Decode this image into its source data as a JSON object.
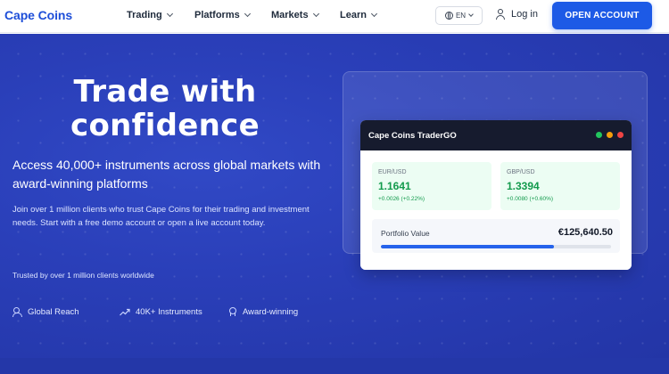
{
  "brand": {
    "name": "Cape Coins",
    "color": "#1d4ed8"
  },
  "nav": {
    "items": [
      {
        "label": "Trading"
      },
      {
        "label": "Platforms"
      },
      {
        "label": "Markets"
      },
      {
        "label": "Learn"
      }
    ],
    "language": "EN",
    "login_label": "Log in",
    "cta_label": "OPEN ACCOUNT",
    "cta_color": "#1d5ae6"
  },
  "hero": {
    "headline": [
      "Trade with",
      "confidence"
    ],
    "subhead": "Access 40,000+ instruments across global markets with award-winning platforms",
    "paragraph": "Join over 1 million clients who trust Cape Coins for their trading and investment needs. Start with a free demo account or open a live account today.",
    "trusted": "Trusted by over 1 million clients worldwide",
    "features": [
      {
        "label": "Global Reach",
        "icon": "users-icon"
      },
      {
        "label": "40K+ Instruments",
        "icon": "trend-up-icon"
      },
      {
        "label": "Award-winning",
        "icon": "award-icon"
      }
    ],
    "background_color": "#2a3fb9"
  },
  "widget": {
    "title": "Cape Coins TraderGO",
    "window_dots": [
      "#22c55e",
      "#f59e0b",
      "#ef4444"
    ],
    "quotes": [
      {
        "pair": "EUR/USD",
        "price": "1.1641",
        "change": "+0.0026 (+0.22%)"
      },
      {
        "pair": "GBP/USD",
        "price": "1.3394",
        "change": "+0.0080 (+0.60%)"
      }
    ],
    "portfolio": {
      "label": "Portfolio Value",
      "value": "€125,640.50",
      "progress": 0.75
    },
    "positive_color": "#129a4c"
  }
}
